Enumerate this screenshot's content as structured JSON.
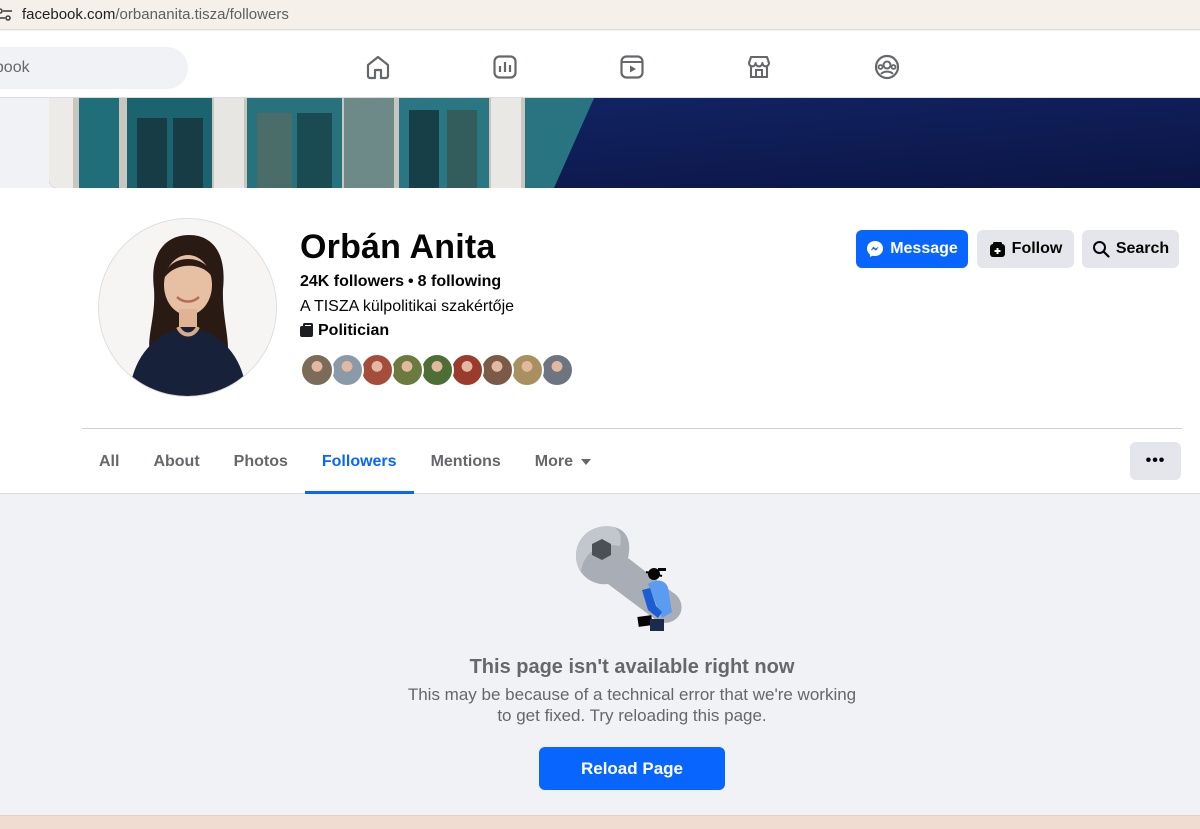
{
  "browser": {
    "url_host": "facebook.com",
    "url_path": "/orbananita.tisza/followers"
  },
  "topnav": {
    "search_placeholder": "ebook",
    "icons": [
      "home-icon",
      "feed-icon",
      "video-icon",
      "marketplace-icon",
      "gaming-icon"
    ]
  },
  "profile": {
    "name": "Orbán Anita",
    "followers": "24K followers",
    "dot": "•",
    "following": "8 following",
    "bio": "A TISZA külpolitikai szakértője",
    "category": "Politician",
    "friend_colors": [
      "#7c6b58",
      "#8a9aa8",
      "#a44d3d",
      "#6b7a3e",
      "#4d6e35",
      "#9b3b2d",
      "#7b5a48",
      "#a89060",
      "#6d7580"
    ]
  },
  "actions": {
    "message": "Message",
    "follow": "Follow",
    "search": "Search",
    "more": "•••"
  },
  "tabs": [
    {
      "label": "All",
      "active": false
    },
    {
      "label": "About",
      "active": false
    },
    {
      "label": "Photos",
      "active": false
    },
    {
      "label": "Followers",
      "active": true
    },
    {
      "label": "Mentions",
      "active": false
    },
    {
      "label": "More",
      "active": false
    }
  ],
  "error": {
    "title": "This page isn't available right now",
    "line1": "This may be because of a technical error that we're working",
    "line2": "to get fixed. Try reloading this page.",
    "reload": "Reload Page"
  },
  "colors": {
    "brand_blue": "#0866ff",
    "secondary_text": "#65676b",
    "button_gray": "#e4e6eb"
  }
}
